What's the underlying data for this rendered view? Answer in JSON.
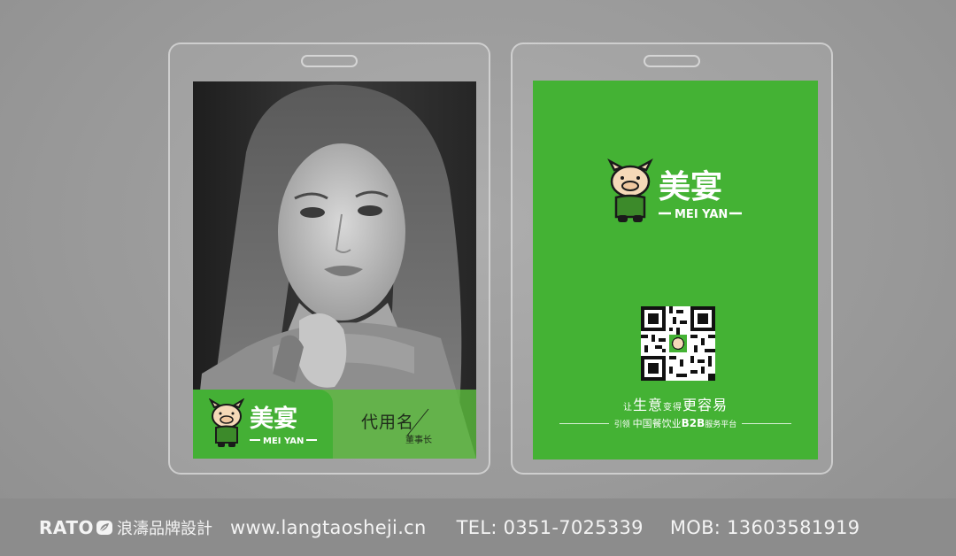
{
  "left_card": {
    "logo_cn": "美宴",
    "logo_en": "MEI YAN",
    "name": "代用名",
    "title": "董事长"
  },
  "right_card": {
    "logo_cn": "美宴",
    "logo_en": "MEI YAN",
    "slogan_parts": [
      "让",
      "生意",
      "变得",
      "更容易"
    ],
    "tagline_pre": "引领",
    "tagline_mid": "中国餐饮业",
    "tagline_b2b": "B2B",
    "tagline_post": "服务平台"
  },
  "footer": {
    "brand": "RATO",
    "brand_cn": "浪濤品牌設計",
    "website": "www.langtaosheji.cn",
    "tel": "TEL: 0351-7025339",
    "mob": "MOB: 13603581919"
  },
  "colors": {
    "brand_green": "#44b234",
    "background": "#9b9b9b"
  },
  "icons": [
    "pig-mascot-icon",
    "qr-code-icon",
    "leaf-logo-icon"
  ]
}
